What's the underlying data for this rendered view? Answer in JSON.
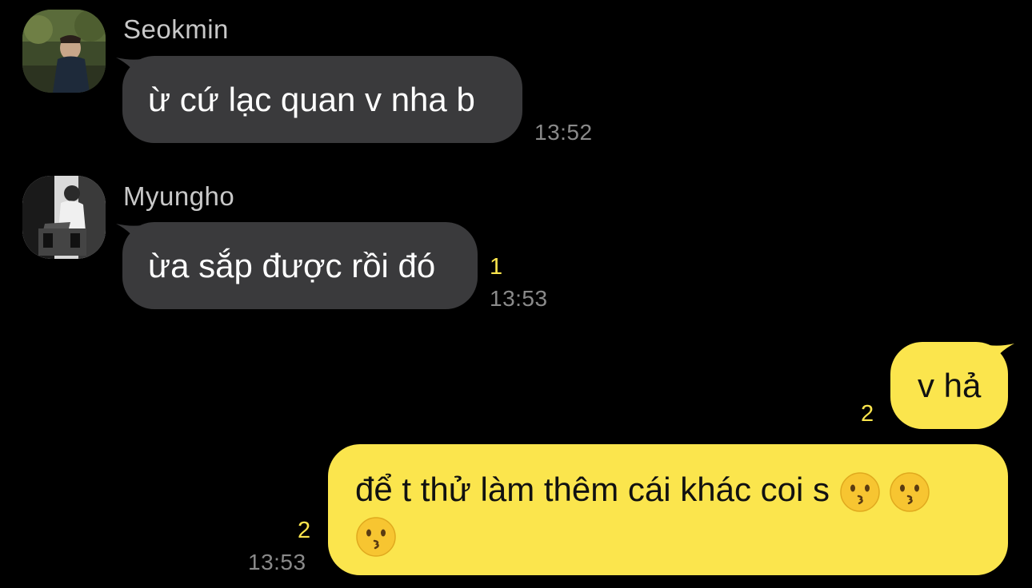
{
  "messages": [
    {
      "sender": "Seokmin",
      "avatar_icon": "profile-photo-outdoor",
      "text": "ừ cứ lạc quan v nha b",
      "time": "13:52",
      "unread": ""
    },
    {
      "sender": "Myungho",
      "avatar_icon": "profile-photo-monochrome",
      "text": "ừa sắp được rồi đó",
      "time": "13:53",
      "unread": "1"
    },
    {
      "sender": "me",
      "text": "v hả",
      "time": "",
      "unread": "2"
    },
    {
      "sender": "me",
      "text": "để t thử làm thêm cái khác coi s",
      "emojis": [
        "kissing-face-emoji",
        "kissing-face-emoji",
        "kissing-face-emoji"
      ],
      "time": "13:53",
      "unread": "2"
    }
  ],
  "colors": {
    "background": "#000000",
    "incoming_bubble": "#3a3a3c",
    "outgoing_bubble": "#fbe54d",
    "unread_count": "#fbe54d",
    "timestamp": "#8a8a8a"
  }
}
